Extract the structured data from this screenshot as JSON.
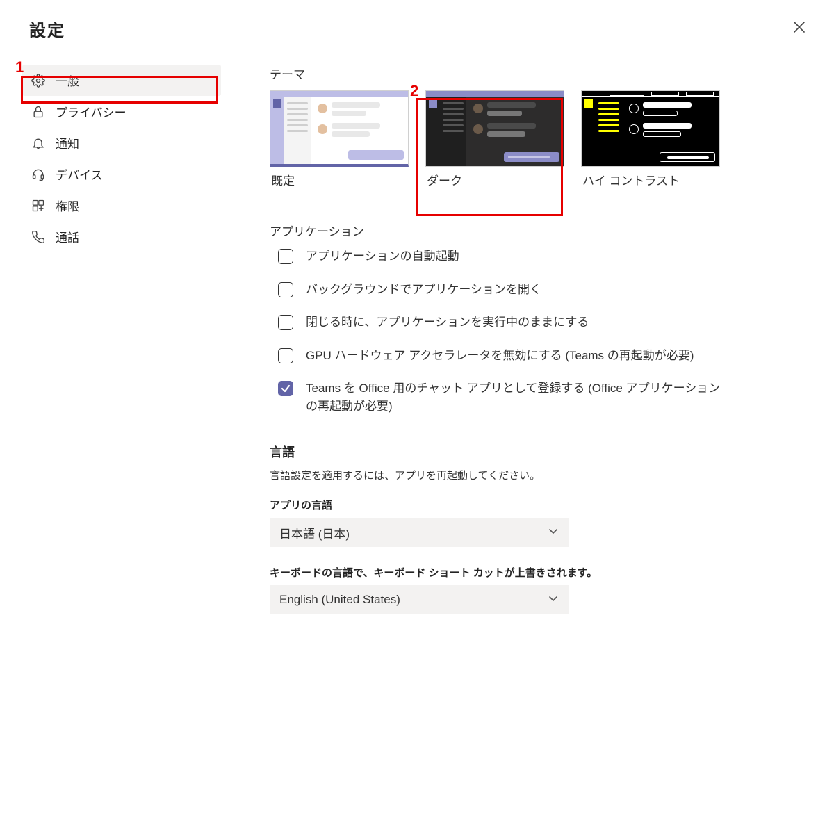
{
  "title": "設定",
  "sidebar": {
    "items": [
      {
        "label": "一般",
        "icon": "gear-icon",
        "active": true
      },
      {
        "label": "プライバシー",
        "icon": "lock-icon",
        "active": false
      },
      {
        "label": "通知",
        "icon": "bell-icon",
        "active": false
      },
      {
        "label": "デバイス",
        "icon": "headset-icon",
        "active": false
      },
      {
        "label": "権限",
        "icon": "apps-icon",
        "active": false
      },
      {
        "label": "通話",
        "icon": "phone-icon",
        "active": false
      }
    ]
  },
  "main": {
    "theme_heading": "テーマ",
    "themes": [
      {
        "label": "既定",
        "kind": "default",
        "selected": true
      },
      {
        "label": "ダーク",
        "kind": "dark",
        "selected": false
      },
      {
        "label": "ハイ コントラスト",
        "kind": "hc",
        "selected": false
      }
    ],
    "app_heading": "アプリケーション",
    "app_options": [
      {
        "label": "アプリケーションの自動起動",
        "checked": false
      },
      {
        "label": "バックグラウンドでアプリケーションを開く",
        "checked": false
      },
      {
        "label": "閉じる時に、アプリケーションを実行中のままにする",
        "checked": false
      },
      {
        "label": "GPU ハードウェア アクセラレータを無効にする (Teams の再起動が必要)",
        "checked": false
      },
      {
        "label": "Teams を Office 用のチャット アプリとして登録する (Office アプリケーションの再起動が必要)",
        "checked": true
      }
    ],
    "language_heading": "言語",
    "language_help": "言語設定を適用するには、アプリを再起動してください。",
    "app_language_label": "アプリの言語",
    "app_language_value": "日本語 (日本)",
    "keyboard_language_label": "キーボードの言語で、キーボード ショート カットが上書きされます。",
    "keyboard_language_value": "English (United States)"
  },
  "annotations": {
    "one": "1",
    "two": "2"
  }
}
